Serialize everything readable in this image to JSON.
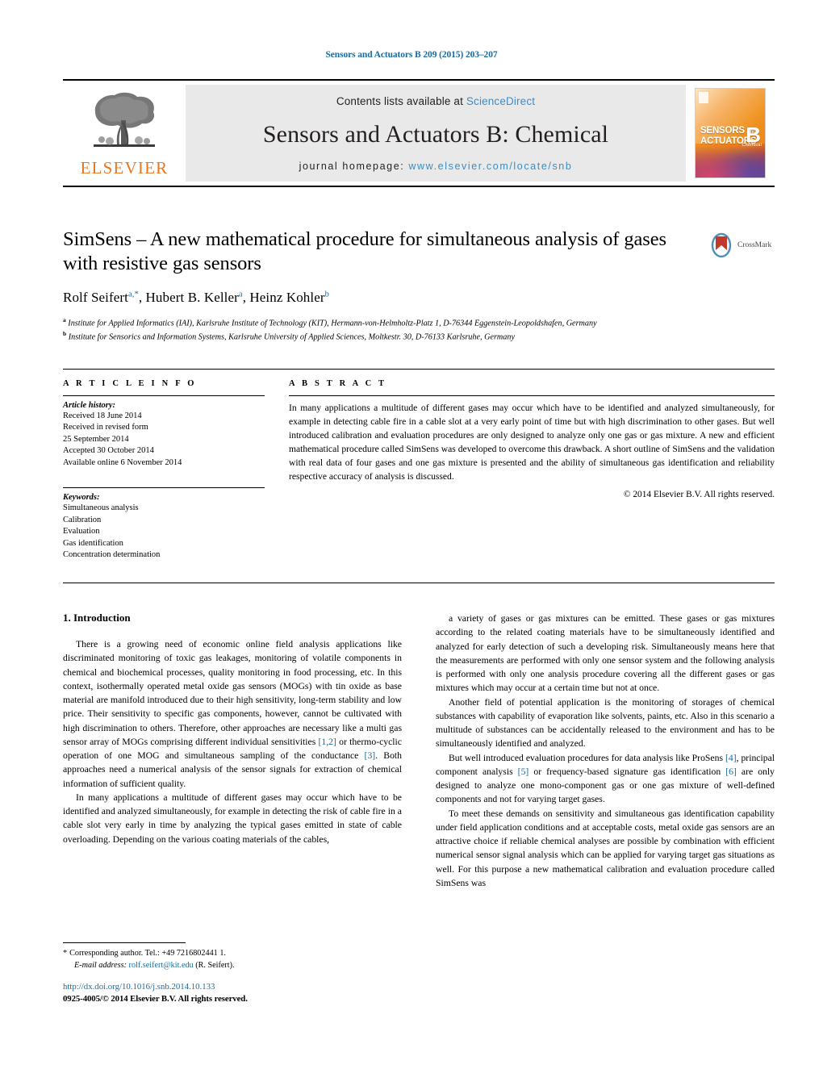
{
  "running_head": "Sensors and Actuators B 209 (2015) 203–207",
  "masthead": {
    "contents_prefix": "Contents lists available at",
    "sciencedirect": "ScienceDirect",
    "journal_title": "Sensors and Actuators B: Chemical",
    "homepage_prefix": "journal homepage:",
    "homepage_url": "www.elsevier.com/locate/snb",
    "publisher_wordmark": "ELSEVIER",
    "cover": {
      "line1": "SENSORS",
      "and": "and",
      "line2": "ACTUATORS",
      "series": "B",
      "subtitle": "Chemical"
    },
    "accent_link_color": "#3c8dc5",
    "publisher_orange": "#E87722"
  },
  "article": {
    "title": "SimSens – A new mathematical procedure for simultaneous analysis of gases with resistive gas sensors",
    "authors_html": "Rolf Seifert<sup>a,*</sup>, Hubert B. Keller<sup>a</sup>, Heinz Kohler<sup>b</sup>",
    "affiliation_a": "Institute for Applied Informatics (IAI), Karlsruhe Institute of Technology (KIT), Hermann-von-Helmholtz-Platz 1, D-76344 Eggenstein-Leopoldshafen, Germany",
    "affiliation_b": "Institute for Sensorics and Information Systems, Karlsruhe University of Applied Sciences, Moltkestr. 30, D-76133 Karlsruhe, Germany",
    "crossmark_label": "CrossMark"
  },
  "article_info": {
    "kicker": "A R T I C L E    I N F O",
    "history_heading": "Article history:",
    "history": [
      "Received 18 June 2014",
      "Received in revised form",
      "25 September 2014",
      "Accepted 30 October 2014",
      "Available online 6 November 2014"
    ],
    "keywords_heading": "Keywords:",
    "keywords": [
      "Simultaneous analysis",
      "Calibration",
      "Evaluation",
      "Gas identification",
      "Concentration determination"
    ]
  },
  "abstract": {
    "kicker": "A B S T R A C T",
    "text": "In many applications a multitude of different gases may occur which have to be identified and analyzed simultaneously, for example in detecting cable fire in a cable slot at a very early point of time but with high discrimination to other gases. But well introduced calibration and evaluation procedures are only designed to analyze only one gas or gas mixture. A new and efficient mathematical procedure called SimSens was developed to overcome this drawback. A short outline of SimSens and the validation with real data of four gases and one gas mixture is presented and the ability of simultaneous gas identification and reliability respective accuracy of analysis is discussed.",
    "copyright": "© 2014 Elsevier B.V. All rights reserved."
  },
  "body": {
    "section_heading": "1. Introduction",
    "left_paragraphs": [
      "There is a growing need of economic online field analysis applications like discriminated monitoring of toxic gas leakages, monitoring of volatile components in chemical and biochemical processes, quality monitoring in food processing, etc. In this context, isothermally operated metal oxide gas sensors (MOGs) with tin oxide as base material are manifold introduced due to their high sensitivity, long-term stability and low price. Their sensitivity to specific gas components, however, cannot be cultivated with high discrimination to others. Therefore, other approaches are necessary like a multi gas sensor array of MOGs comprising different individual sensitivities [1,2] or thermo-cyclic operation of one MOG and simultaneous sampling of the conductance [3]. Both approaches need a numerical analysis of the sensor signals for extraction of chemical information of sufficient quality.",
      "In many applications a multitude of different gases may occur which have to be identified and analyzed simultaneously, for example in detecting the risk of cable fire in a cable slot very early in time by analyzing the typical gases emitted in state of cable overloading. Depending on the various coating materials of the cables,"
    ],
    "right_paragraphs": [
      "a variety of gases or gas mixtures can be emitted. These gases or gas mixtures according to the related coating materials have to be simultaneously identified and analyzed for early detection of such a developing risk. Simultaneously means here that the measurements are performed with only one sensor system and the following analysis is performed with only one analysis procedure covering all the different gases or gas mixtures which may occur at a certain time but not at once.",
      "Another field of potential application is the monitoring of storages of chemical substances with capability of evaporation like solvents, paints, etc. Also in this scenario a multitude of substances can be accidentally released to the environment and has to be simultaneously identified and analyzed.",
      "But well introduced evaluation procedures for data analysis like ProSens [4], principal component analysis [5] or frequency-based signature gas identification [6] are only designed to analyze one mono-component gas or one gas mixture of well-defined components and not for varying target gases.",
      "To meet these demands on sensitivity and simultaneous gas identification capability under field application conditions and at acceptable costs, metal oxide gas sensors are an attractive choice if reliable chemical analyses are possible by combination with efficient numerical sensor signal analysis which can be applied for varying target gas situations as well. For this purpose a new mathematical calibration and evaluation procedure called SimSens was"
    ],
    "reference_marks": [
      "[1,2]",
      "[3]",
      "[4]",
      "[5]",
      "[6]"
    ],
    "reference_link_color": "#1a6ba0"
  },
  "footer": {
    "corresponding_marker": "*",
    "corresponding_text": "Corresponding author. Tel.: +49 7216802441 1.",
    "email_label": "E-mail address:",
    "email": "rolf.seifert@kit.edu",
    "email_suffix": "(R. Seifert).",
    "doi_url": "http://dx.doi.org/10.1016/j.snb.2014.10.133",
    "issn_line": "0925-4005/© 2014 Elsevier B.V. All rights reserved."
  }
}
